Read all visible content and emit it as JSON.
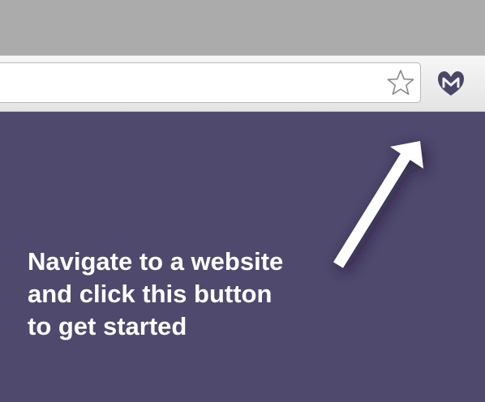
{
  "browser": {
    "bookmark_icon": "star-outline-icon",
    "extension_icon": "extension-logo-icon"
  },
  "colors": {
    "page_background": "#4e496d",
    "chrome_top": "#ababab",
    "toolbar": "#eeeeee",
    "logo": "#4a4668",
    "text": "#ffffff"
  },
  "main": {
    "hint_text": "Navigate to a website\nand click this button\nto get started",
    "arrow_icon": "arrow-up-right-icon"
  }
}
